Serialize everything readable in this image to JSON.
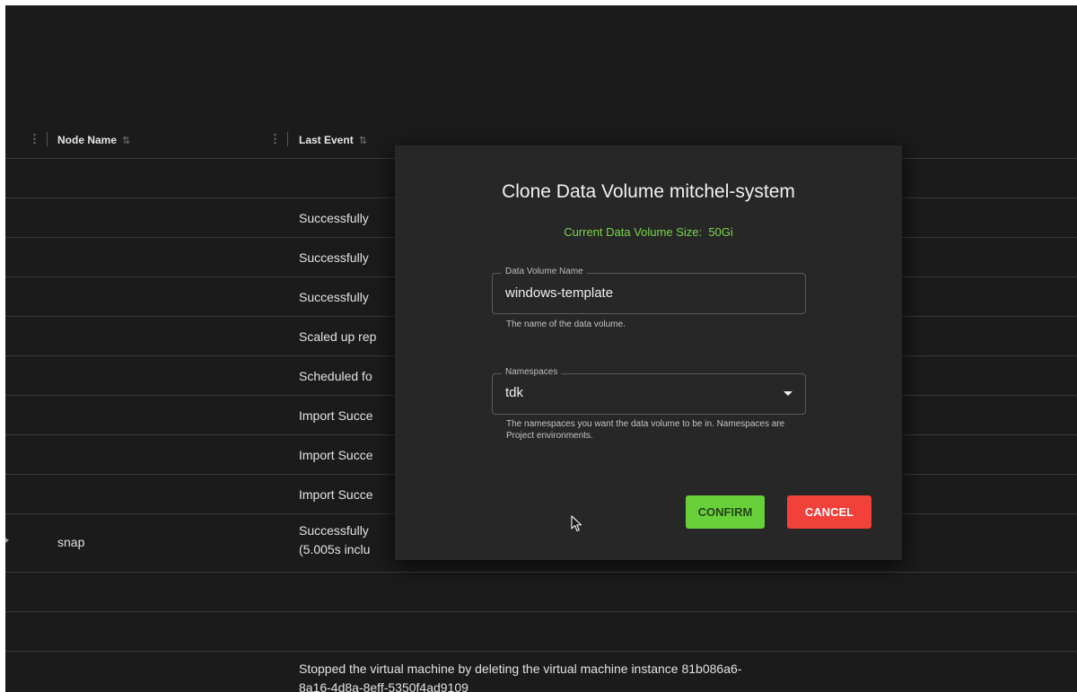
{
  "table": {
    "columns": [
      {
        "label": "Node Name"
      },
      {
        "label": "Last Event"
      }
    ],
    "rows": [
      {
        "node": "",
        "event": ""
      },
      {
        "node": "",
        "event": "Successfully"
      },
      {
        "node": "",
        "event": "Successfully"
      },
      {
        "node": "",
        "event": "Successfully"
      },
      {
        "node": "",
        "event": "Scaled up rep"
      },
      {
        "node": "",
        "event": "Scheduled fo"
      },
      {
        "node": "",
        "event": "Import Succe"
      },
      {
        "node": "",
        "event": "Import Succe"
      },
      {
        "node": "",
        "event": "Import Succe"
      },
      {
        "node": "snap",
        "event": "Successfully",
        "event_line2": "(5.005s inclu"
      },
      {
        "node": "",
        "event": ""
      },
      {
        "node": "",
        "event": ""
      },
      {
        "node": "",
        "event": "Stopped the virtual machine by deleting the virtual machine instance 81b086a6-",
        "event_line2": "8a16-4d8a-8eff-5350f4ad9109"
      }
    ]
  },
  "dialog": {
    "title": "Clone Data Volume mitchel-system",
    "size_label": "Current Data Volume Size:",
    "size_value": "50Gi",
    "name_field": {
      "label": "Data Volume Name",
      "value": "windows-template",
      "helper": "The name of the data volume."
    },
    "namespace_field": {
      "label": "Namespaces",
      "value": "tdk",
      "helper": "The namespaces you want the data volume to be in. Namespaces are Project environments."
    },
    "confirm_label": "CONFIRM",
    "cancel_label": "CANCEL"
  },
  "colors": {
    "background": "#1b1b1b",
    "dialog": "#272727",
    "accent_green": "#7ad44a",
    "confirm": "#68d13a",
    "cancel": "#f2403a"
  }
}
